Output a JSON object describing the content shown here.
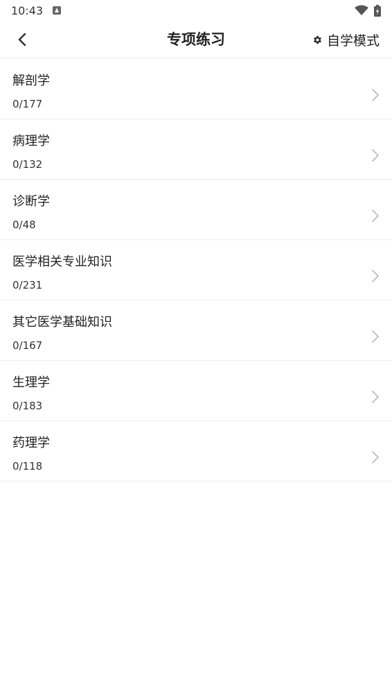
{
  "status": {
    "time": "10:43"
  },
  "header": {
    "title": "专项练习",
    "mode_label": "自学模式"
  },
  "items": [
    {
      "title": "解剖学",
      "progress": "0/177"
    },
    {
      "title": "病理学",
      "progress": "0/132"
    },
    {
      "title": "诊断学",
      "progress": "0/48"
    },
    {
      "title": "医学相关专业知识",
      "progress": "0/231"
    },
    {
      "title": "其它医学基础知识",
      "progress": "0/167"
    },
    {
      "title": "生理学",
      "progress": "0/183"
    },
    {
      "title": "药理学",
      "progress": "0/118"
    }
  ],
  "icons": {
    "back": "chevron-left-icon",
    "mode": "gear-icon",
    "item_arrow": "chevron-right-icon"
  },
  "colors": {
    "text": "#222222",
    "divider": "#eeeeee",
    "chevron": "#bbbbbb"
  }
}
